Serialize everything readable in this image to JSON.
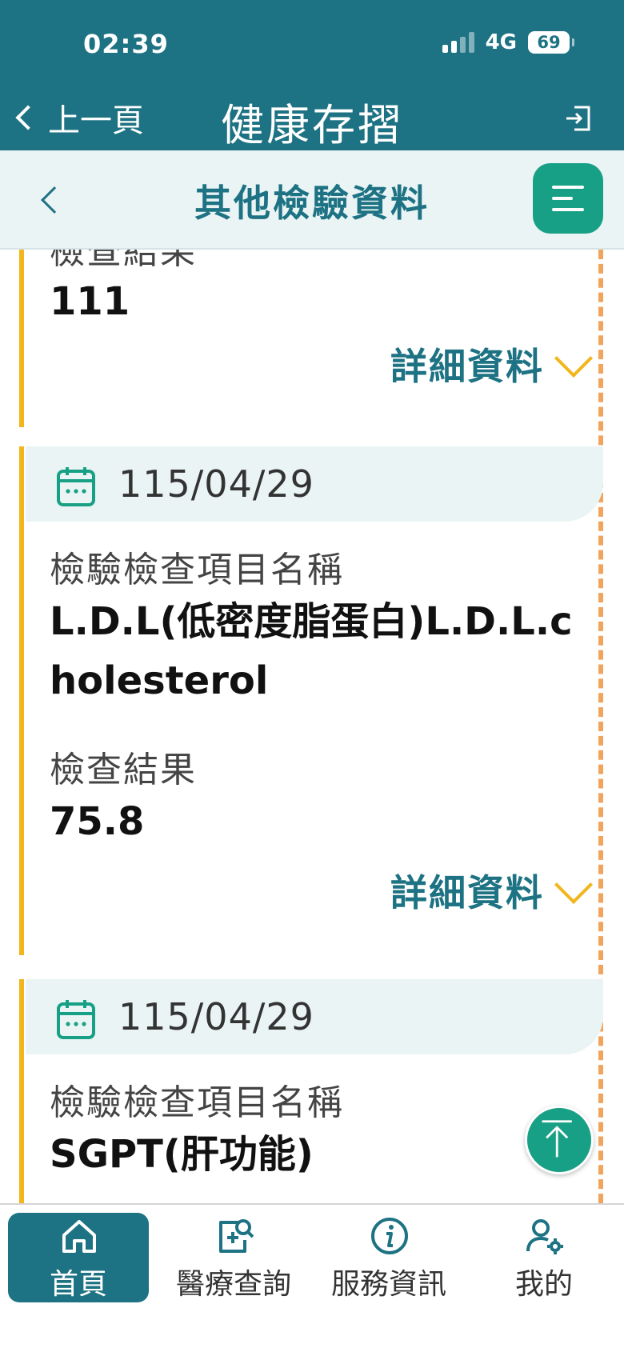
{
  "status": {
    "time": "02:39",
    "network": "4G",
    "battery": "69"
  },
  "header": {
    "back_label": "上一頁",
    "title": "健康存摺"
  },
  "subheader": {
    "title": "其他檢驗資料"
  },
  "records": [
    {
      "result_label": "檢查結果",
      "result_value": "111",
      "detail_label": "詳細資料"
    },
    {
      "date": "115/04/29",
      "item_label": "檢驗檢查項目名稱",
      "item_value": "L.D.L(低密度脂蛋白)L.D.L.cholesterol",
      "result_label": "檢查結果",
      "result_value": "75.8",
      "detail_label": "詳細資料"
    },
    {
      "date": "115/04/29",
      "item_label": "檢驗檢查項目名稱",
      "item_value": "SGPT(肝功能)"
    }
  ],
  "nav": [
    {
      "label": "首頁",
      "icon": "home-icon",
      "active": true
    },
    {
      "label": "醫療查詢",
      "icon": "medical-search-icon",
      "active": false
    },
    {
      "label": "服務資訊",
      "icon": "info-icon",
      "active": false
    },
    {
      "label": "我的",
      "icon": "user-settings-icon",
      "active": false
    }
  ],
  "colors": {
    "primary": "#1d7283",
    "accent_green": "#17a085",
    "accent_yellow": "#f2b51c",
    "dashed_orange": "#f0a45c",
    "band_bg": "#eaf4f4"
  }
}
